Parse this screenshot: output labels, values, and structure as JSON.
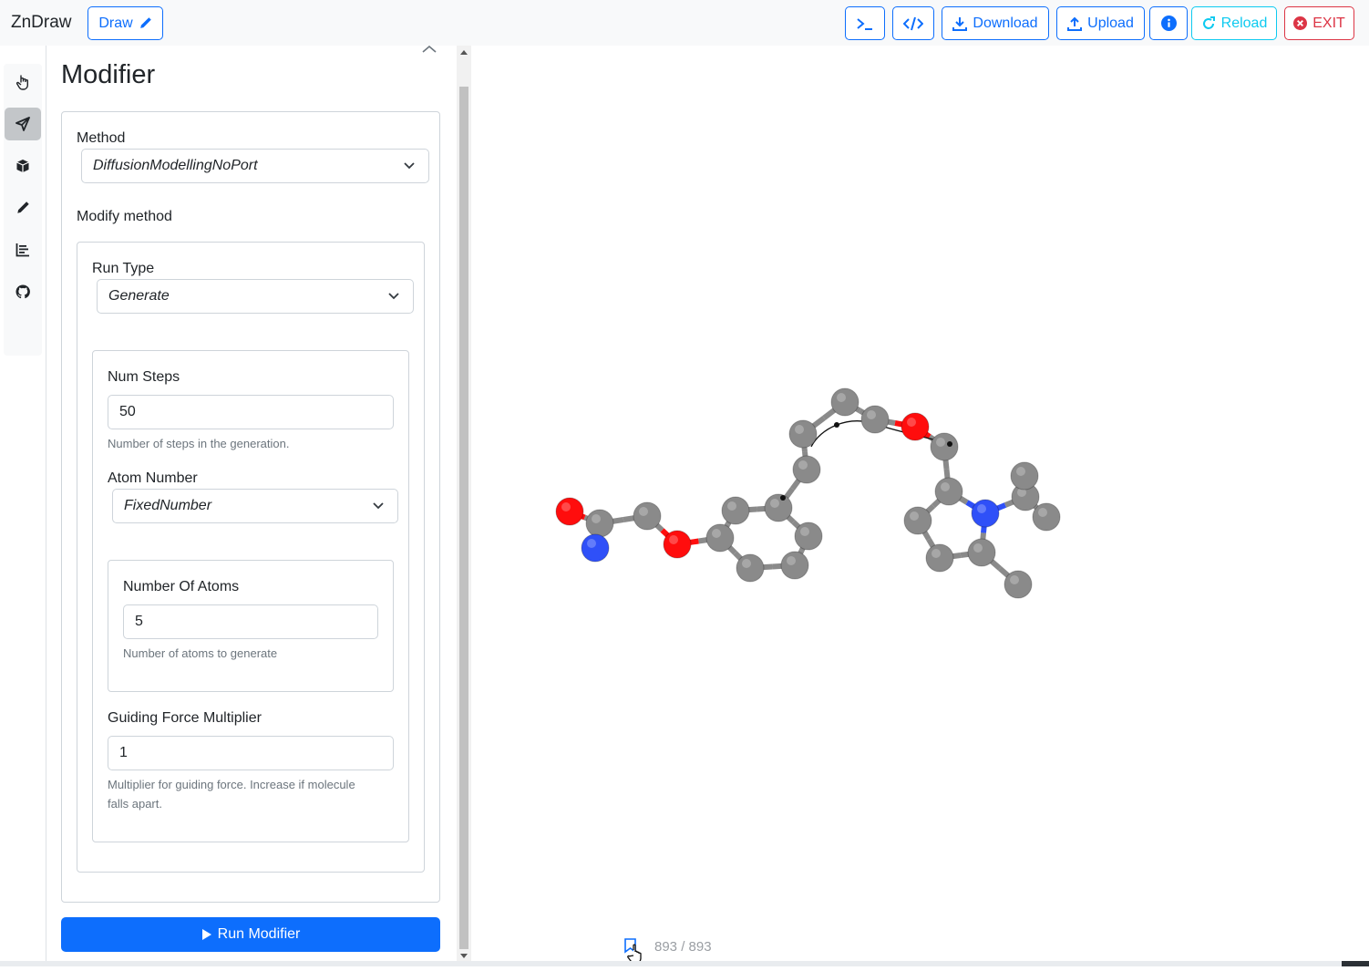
{
  "navbar": {
    "brand": "ZnDraw",
    "draw_label": "Draw",
    "download_label": "Download",
    "upload_label": "Upload",
    "reload_label": "Reload",
    "exit_label": "EXIT"
  },
  "rail": {
    "items": [
      "hand-pointer-icon",
      "send-icon",
      "cube-icon",
      "pencil-icon",
      "chart-icon",
      "github-icon"
    ],
    "active_index": 1
  },
  "panel": {
    "title": "Modifier",
    "method_label": "Method",
    "method_value": "DiffusionModellingNoPort",
    "modify_method_label": "Modify method",
    "run_type_label": "Run Type",
    "run_type_value": "Generate",
    "num_steps_label": "Num Steps",
    "num_steps_value": "50",
    "num_steps_help": "Number of steps in the generation.",
    "atom_number_label": "Atom Number",
    "atom_number_value": "FixedNumber",
    "number_of_atoms_label": "Number Of Atoms",
    "number_of_atoms_value": "5",
    "number_of_atoms_help": "Number of atoms to generate",
    "guiding_force_label": "Guiding Force Multiplier",
    "guiding_force_value": "1",
    "guiding_force_help_1": "Multiplier for guiding force. Increase if molecule",
    "guiding_force_help_2": "falls apart.",
    "run_button_label": "Run Modifier"
  },
  "viewer": {
    "frame_counter": "893 / 893"
  },
  "colors": {
    "primary": "#0d6efd",
    "info": "#0dcaf0",
    "danger": "#dc3545",
    "carbon": "#8a8a8a",
    "oxygen": "#ff0d0d",
    "nitrogen": "#2f50f8"
  }
}
